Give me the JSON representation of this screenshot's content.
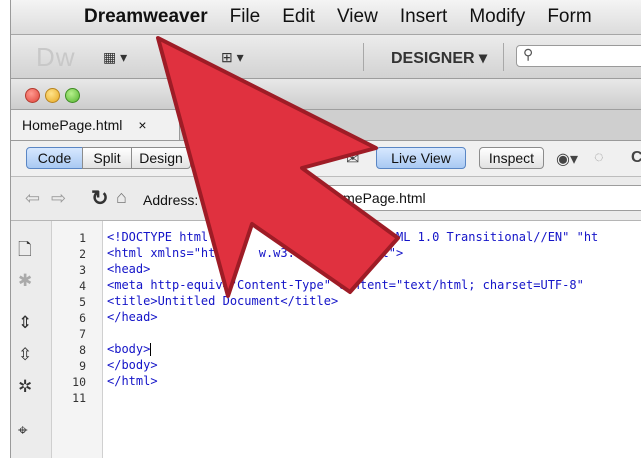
{
  "menubar": {
    "app_name": "Dreamweaver",
    "items": [
      "File",
      "Edit",
      "View",
      "Insert",
      "Modify",
      "Form"
    ]
  },
  "app_toolbar": {
    "logo": "Dw",
    "workspace_label": "DESIGNER ▾",
    "search_icon": "search-icon"
  },
  "window": {
    "tab_title": "HomePage.html",
    "tab_close": "×"
  },
  "doc_toolbar": {
    "code_label": "Code",
    "split_label": "Split",
    "design_label": "Design",
    "live_view_label": "Live View",
    "inspect_label": "Inspect"
  },
  "address_bar": {
    "label": "Address:",
    "value": "file                        HomePage.html"
  },
  "editor": {
    "line_numbers": [
      "1",
      "2",
      "3",
      "4",
      "5",
      "6",
      "7",
      "8",
      "9",
      "10",
      "11"
    ],
    "code_lines": [
      "<!DOCTYPE html PUB      \"-//W3C//       ML 1.0 Transitional//EN\" \"ht",
      "<html xmlns=\"http:/  w.w3.org/1  /xhtml\">",
      "<head>",
      "<meta http-equiv=\"Content-Type\" content=\"text/html; charset=UTF-8\"",
      "<title>Untitled Document</title>",
      "</head>",
      "",
      "<body>",
      "</body>",
      "</html>",
      ""
    ]
  },
  "colors": {
    "accent_arrow": "#e0313f",
    "code_text": "#1414c8",
    "active_button": "#a9c9f2"
  }
}
